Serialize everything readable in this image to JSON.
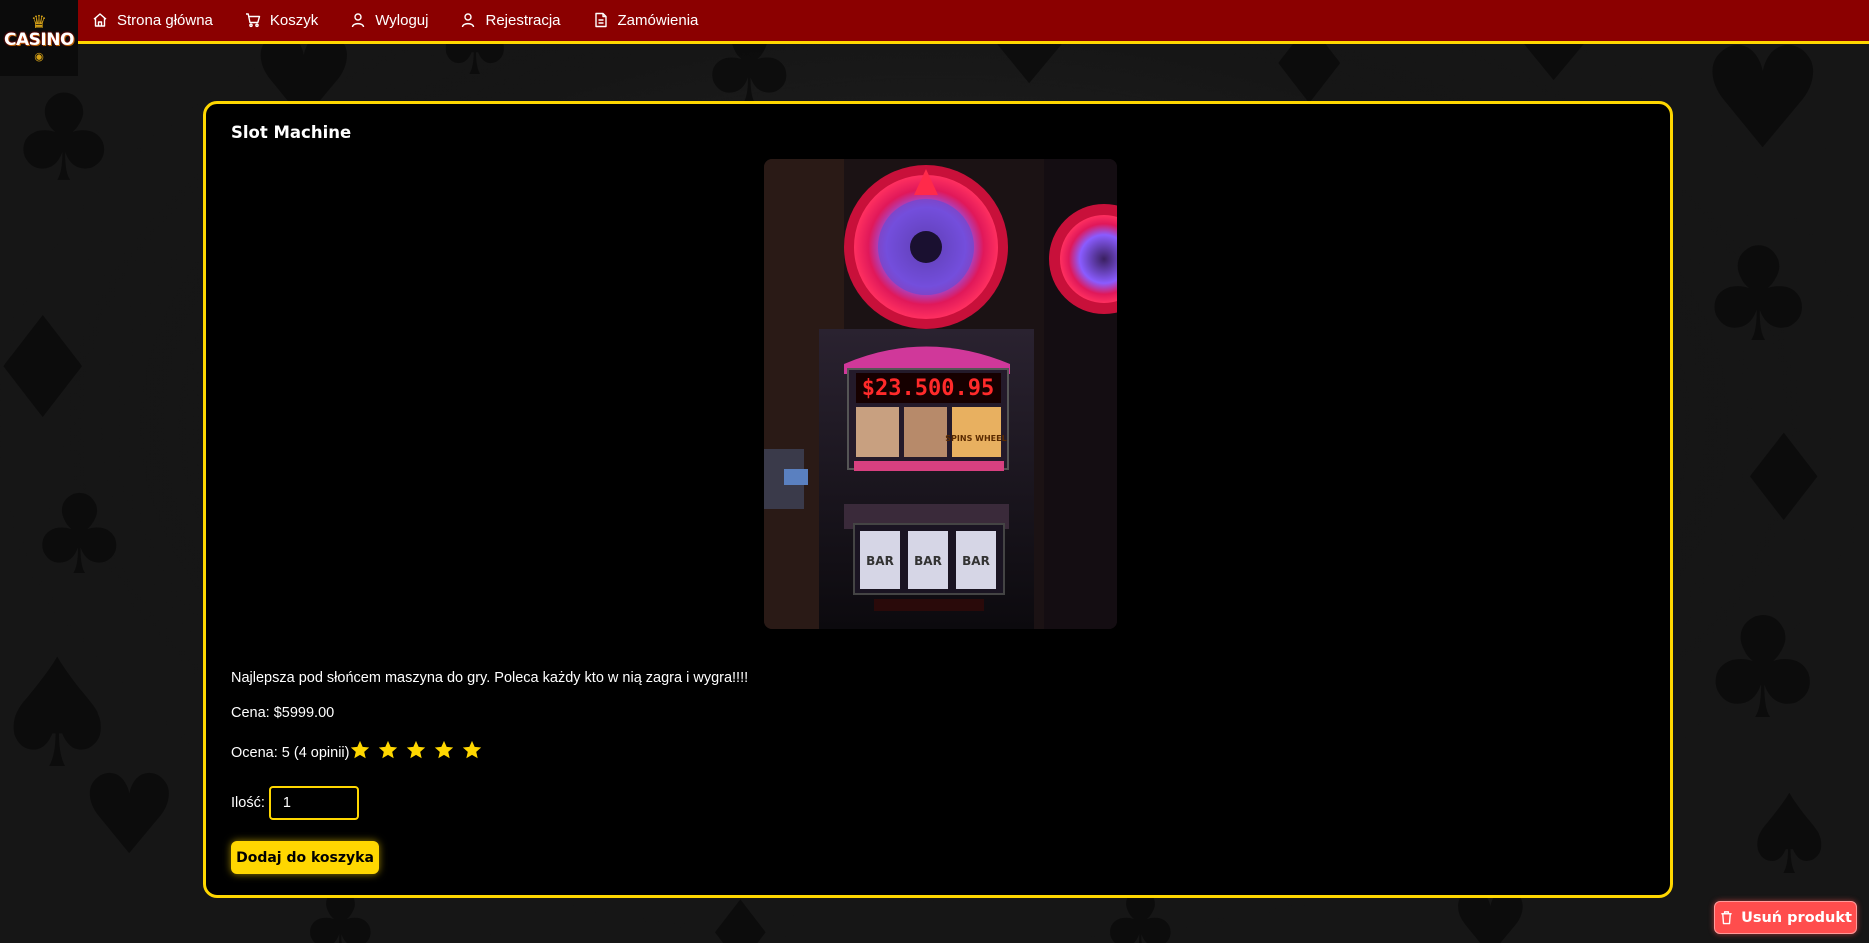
{
  "logo": {
    "text": "CASINO"
  },
  "nav": {
    "items": [
      {
        "label": "Strona główna",
        "icon": "home-icon"
      },
      {
        "label": "Koszyk",
        "icon": "cart-icon"
      },
      {
        "label": "Wyloguj",
        "icon": "user-icon"
      },
      {
        "label": "Rejestracja",
        "icon": "user-icon"
      },
      {
        "label": "Zamówienia",
        "icon": "document-icon"
      }
    ]
  },
  "product": {
    "title": "Slot Machine",
    "image_jackpot": "$23.500.95",
    "image_symbols": [
      "BAR",
      "BAR",
      "BAR"
    ],
    "image_wheel_label": "SPINS WHEEL",
    "description": "Najlepsza pod słońcem maszyna do gry. Poleca każdy kto w nią zagra i wygra!!!!",
    "price_label": "Cena: $5999.00",
    "rating_label": "Ocena: 5 (4 opinii)",
    "rating_value": 5,
    "rating_max": 5,
    "quantity_label": "Ilość:",
    "quantity_value": "1",
    "add_to_cart_label": "Dodaj do koszyka"
  },
  "admin": {
    "delete_label": "Usuń produkt"
  },
  "colors": {
    "nav_bg": "#8b0000",
    "accent": "#ffd700",
    "card_bg": "#000000",
    "delete_bg": "#ff4d4d"
  }
}
